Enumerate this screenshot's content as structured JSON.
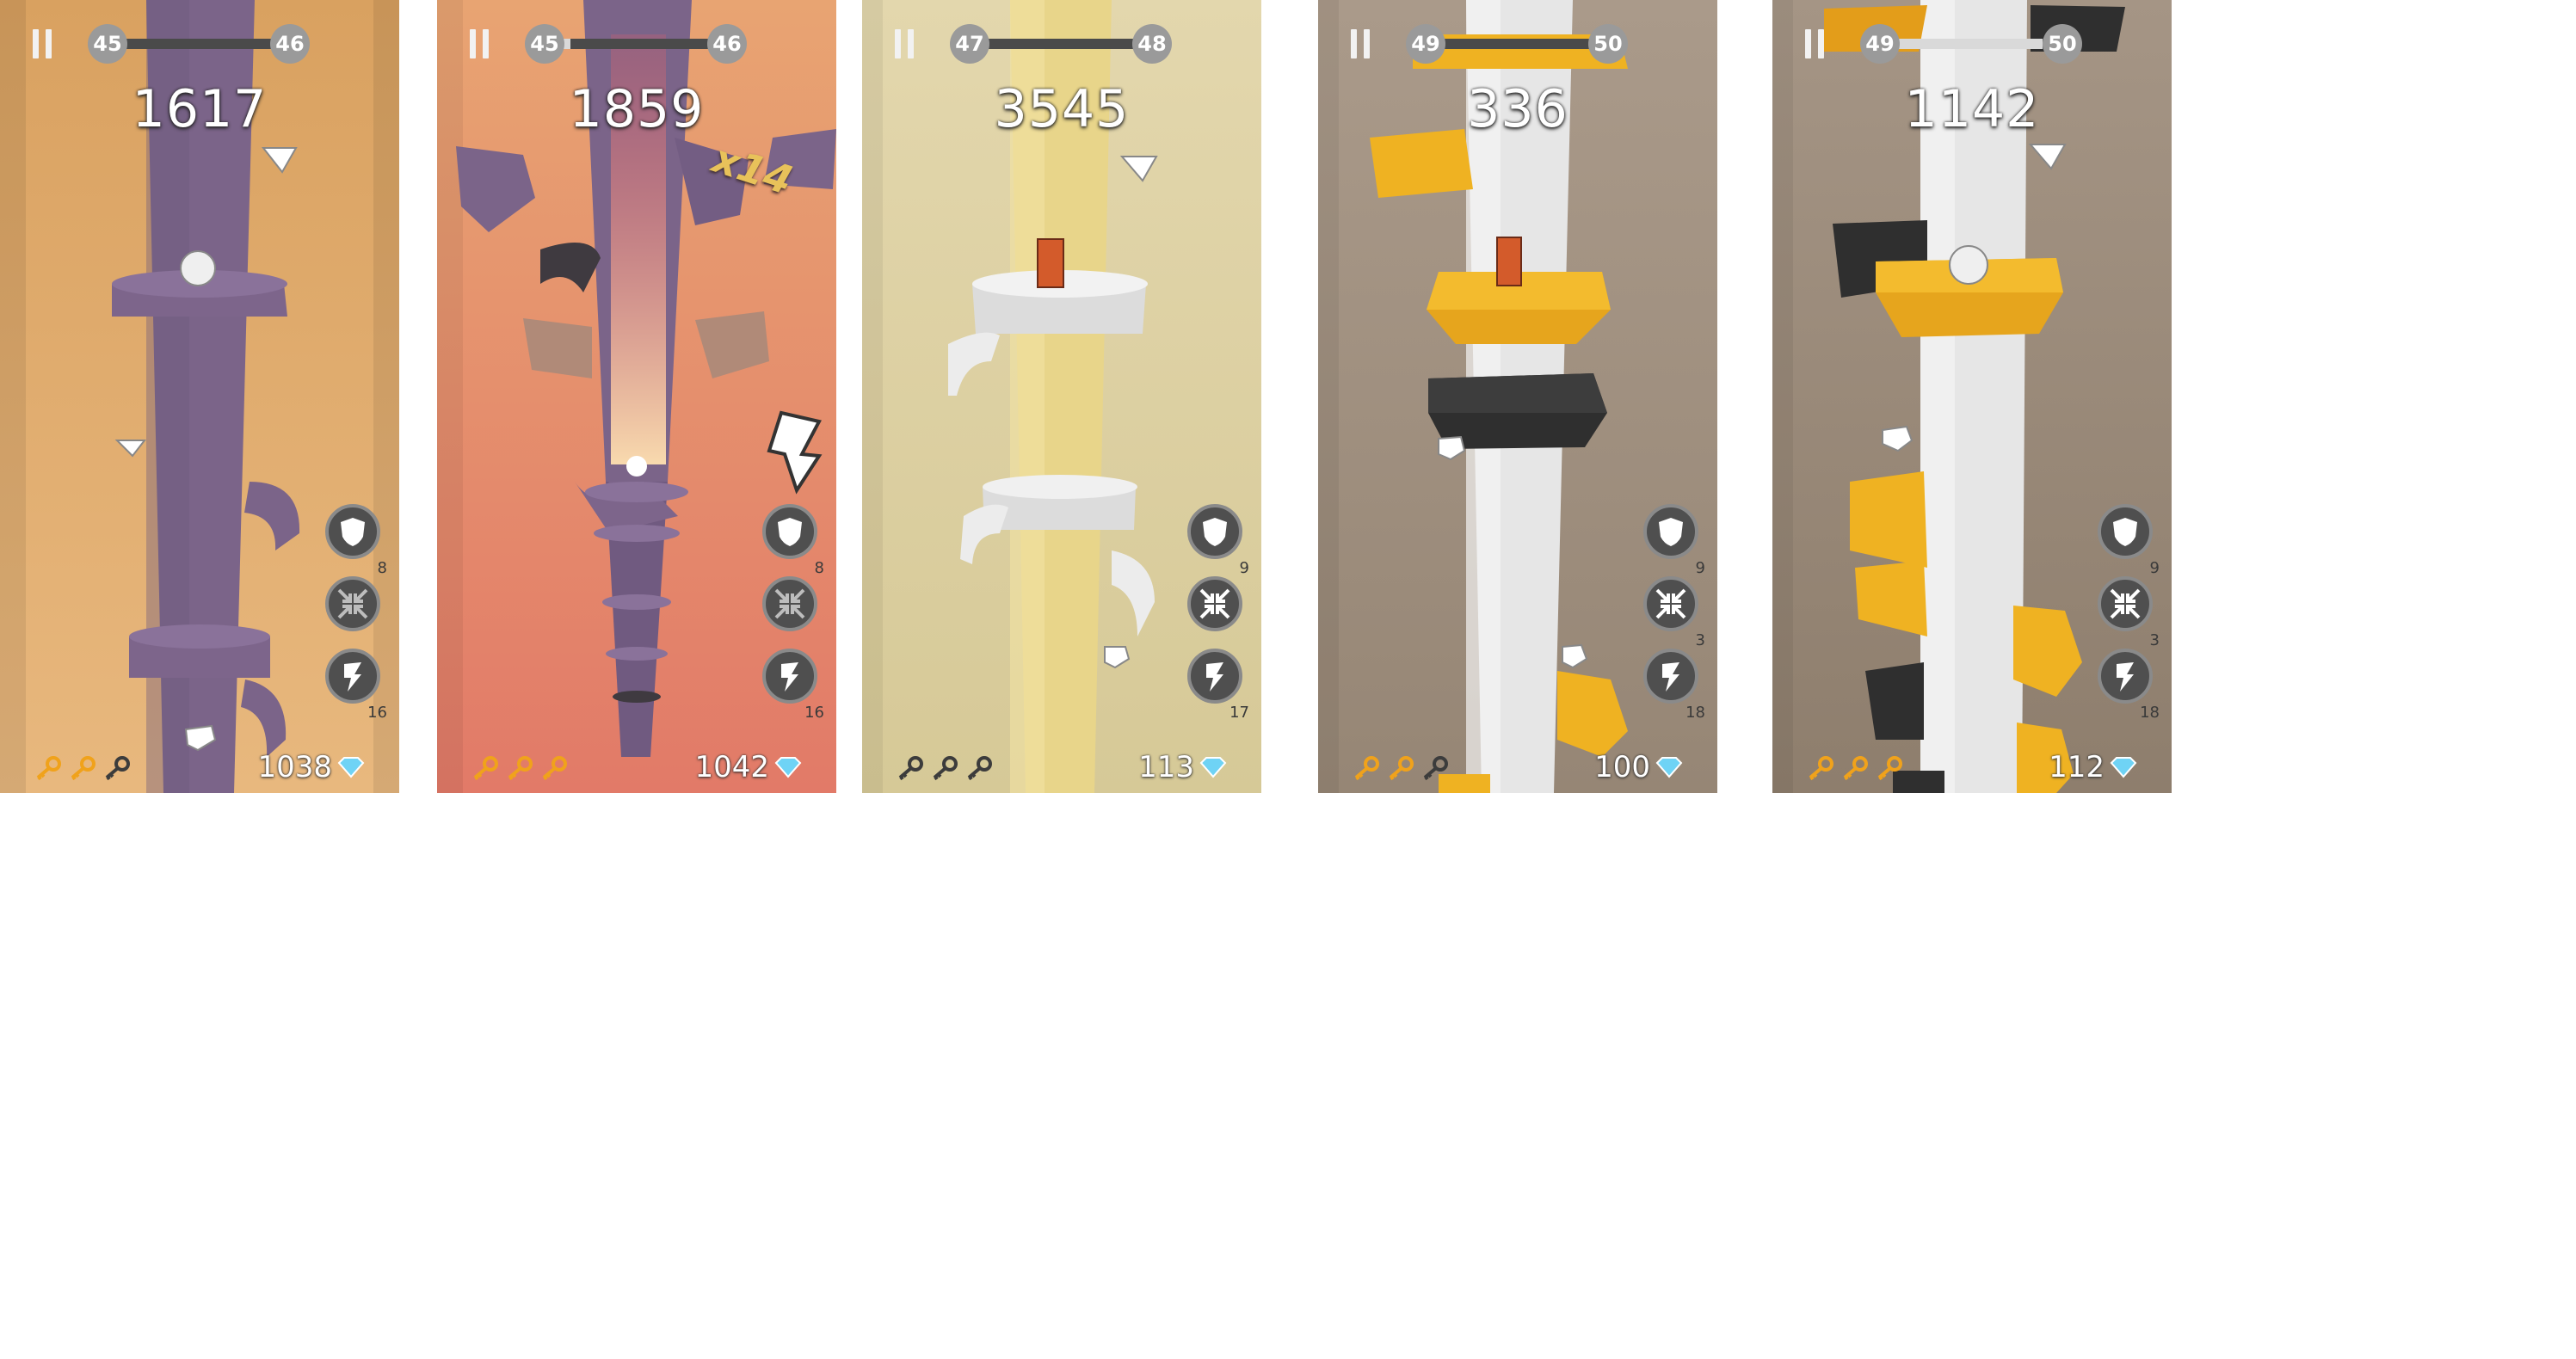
{
  "panels": [
    {
      "id": "p1",
      "score": "1617",
      "level_current": "45",
      "level_next": "46",
      "progress": 0.0,
      "gems": "1038",
      "keys_collected": 2,
      "keys_total": 3,
      "powerups": {
        "shield": "8",
        "shrink": "",
        "bolt": "16"
      },
      "theme": {
        "bg_top": "#d9a160",
        "bg_bottom": "#e4b27b",
        "pole": "#7b6489",
        "accent": "#7b6489"
      }
    },
    {
      "id": "p2",
      "score": "1859",
      "level_current": "45",
      "level_next": "46",
      "progress": 0.15,
      "gems": "1042",
      "keys_collected": 3,
      "keys_total": 3,
      "multiplier": "x14",
      "powerups": {
        "shield": "8",
        "shrink": "",
        "bolt": "16"
      },
      "theme": {
        "bg_top": "#e8a472",
        "bg_bottom": "#e27a68",
        "pole": "#7b6489",
        "accent": "#7b6489"
      }
    },
    {
      "id": "p3",
      "score": "3545",
      "level_current": "47",
      "level_next": "48",
      "progress": 0.05,
      "gems": "113",
      "keys_collected": 0,
      "keys_total": 3,
      "powerups": {
        "shield": "9",
        "shrink": "",
        "bolt": "17"
      },
      "theme": {
        "bg_top": "#e3d7ad",
        "bg_bottom": "#d8cc9c",
        "pole": "#e8d58a",
        "accent": "#e5e5e5"
      }
    },
    {
      "id": "p4",
      "score": "336",
      "level_current": "49",
      "level_next": "50",
      "progress": 0.1,
      "gems": "100",
      "keys_collected": 2,
      "keys_total": 3,
      "powerups": {
        "shield": "9",
        "shrink": "3",
        "bolt": "18"
      },
      "theme": {
        "bg_top": "#aa9a8a",
        "bg_bottom": "#978776",
        "pole": "#e6e6e6",
        "accent": "#efb222"
      }
    },
    {
      "id": "p5",
      "score": "1142",
      "level_current": "49",
      "level_next": "50",
      "progress": 0.88,
      "gems": "112",
      "keys_collected": 3,
      "keys_total": 3,
      "powerups": {
        "shield": "9",
        "shrink": "3",
        "bolt": "18"
      },
      "theme": {
        "bg_top": "#a59585",
        "bg_bottom": "#8f7f6e",
        "pole": "#e6e6e6",
        "accent": "#efb222"
      }
    }
  ],
  "colors": {
    "key_gold": "#f0a21b",
    "key_dark": "#3c3c3c",
    "gem_blue": "#6fd3f5"
  }
}
